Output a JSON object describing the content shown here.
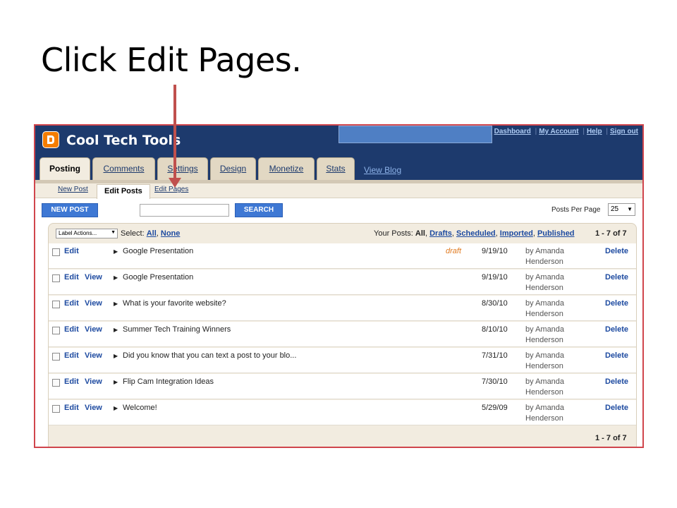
{
  "slide": {
    "title": "Click Edit Pages."
  },
  "header": {
    "blog_name": "Cool Tech Tools",
    "links": [
      "Dashboard",
      "My Account",
      "Help",
      "Sign out"
    ],
    "tabs": [
      "Posting",
      "Comments",
      "Settings",
      "Design",
      "Monetize",
      "Stats"
    ],
    "view_blog": "View Blog"
  },
  "subtabs": [
    "New Post",
    "Edit Posts",
    "Edit Pages"
  ],
  "toolbar": {
    "new_post": "NEW POST",
    "search_value": "",
    "search_button": "SEARCH",
    "per_page_label": "Posts Per Page",
    "per_page_value": "25"
  },
  "listbar": {
    "label_actions": "Label Actions...",
    "select_label": "Select:",
    "select_all": "All",
    "select_none": "None",
    "your_posts": "Your Posts:",
    "filter_all": "All",
    "filters": [
      "Drafts",
      "Scheduled",
      "Imported",
      "Published"
    ],
    "count": "1 - 7 of 7"
  },
  "posts": [
    {
      "edit": "Edit",
      "view": "",
      "title": "Google Presentation",
      "status": "draft",
      "date": "9/19/10",
      "author_line1": "by Amanda",
      "author_line2": "Henderson",
      "delete": "Delete"
    },
    {
      "edit": "Edit",
      "view": "View",
      "title": "Google Presentation",
      "status": "",
      "date": "9/19/10",
      "author_line1": "by Amanda",
      "author_line2": "Henderson",
      "delete": "Delete"
    },
    {
      "edit": "Edit",
      "view": "View",
      "title": "What is your favorite website?",
      "status": "",
      "date": "8/30/10",
      "author_line1": "by Amanda",
      "author_line2": "Henderson",
      "delete": "Delete"
    },
    {
      "edit": "Edit",
      "view": "View",
      "title": "Summer Tech Training Winners",
      "status": "",
      "date": "8/10/10",
      "author_line1": "by Amanda",
      "author_line2": "Henderson",
      "delete": "Delete"
    },
    {
      "edit": "Edit",
      "view": "View",
      "title": "Did you know that you can text a post to your blo...",
      "status": "",
      "date": "7/31/10",
      "author_line1": "by Amanda",
      "author_line2": "Henderson",
      "delete": "Delete"
    },
    {
      "edit": "Edit",
      "view": "View",
      "title": "Flip Cam Integration Ideas",
      "status": "",
      "date": "7/30/10",
      "author_line1": "by Amanda",
      "author_line2": "Henderson",
      "delete": "Delete"
    },
    {
      "edit": "Edit",
      "view": "View",
      "title": "Welcome!",
      "status": "",
      "date": "5/29/09",
      "author_line1": "by Amanda",
      "author_line2": "Henderson",
      "delete": "Delete"
    }
  ],
  "colors": {
    "header": "#1d3a6d",
    "accent_button": "#3e78d4",
    "arrow": "#c0504d",
    "draft": "#e07a1f"
  }
}
